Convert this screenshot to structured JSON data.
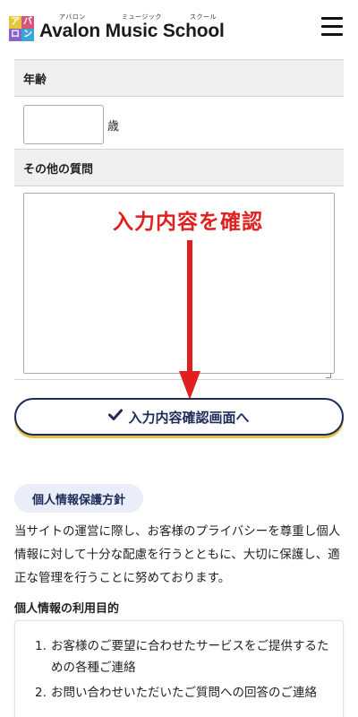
{
  "header": {
    "logo_chars": [
      "ア",
      "バ",
      "ロ",
      "ン"
    ],
    "brand_title": "Avalon Music School",
    "ruby_avalon": "アバロン",
    "ruby_music": "ミュージック",
    "ruby_school": "スクール",
    "menu_icon": "hamburger-icon"
  },
  "form": {
    "age_label": "年齢",
    "age_value": "",
    "age_unit": "歳",
    "other_label": "その他の質問",
    "other_value": "",
    "confirm_label": "入力内容確認画面へ",
    "confirm_icon": "check-icon"
  },
  "annotation": {
    "text": "入力内容を確認",
    "color": "#e02020"
  },
  "privacy": {
    "title": "個人情報保護方針",
    "body": "当サイトの運営に際し、お客様のプライバシーを尊重し個人情報に対して十分な配慮を行うとともに、大切に保護し、適正な管理を行うことに努めております。",
    "purpose_title": "個人情報の利用目的",
    "purposes": [
      {
        "num": "1.",
        "text": "お客様のご要望に合わせたサービスをご提供するための各種ご連絡"
      },
      {
        "num": "2.",
        "text": "お問い合わせいただいたご質問への回答のご連絡"
      }
    ]
  },
  "colors": {
    "brand_navy": "#1e2a5a",
    "accent_yellow": "#e6c13e",
    "arrow_red": "#e02020",
    "pill_bg": "#e9eef8"
  }
}
